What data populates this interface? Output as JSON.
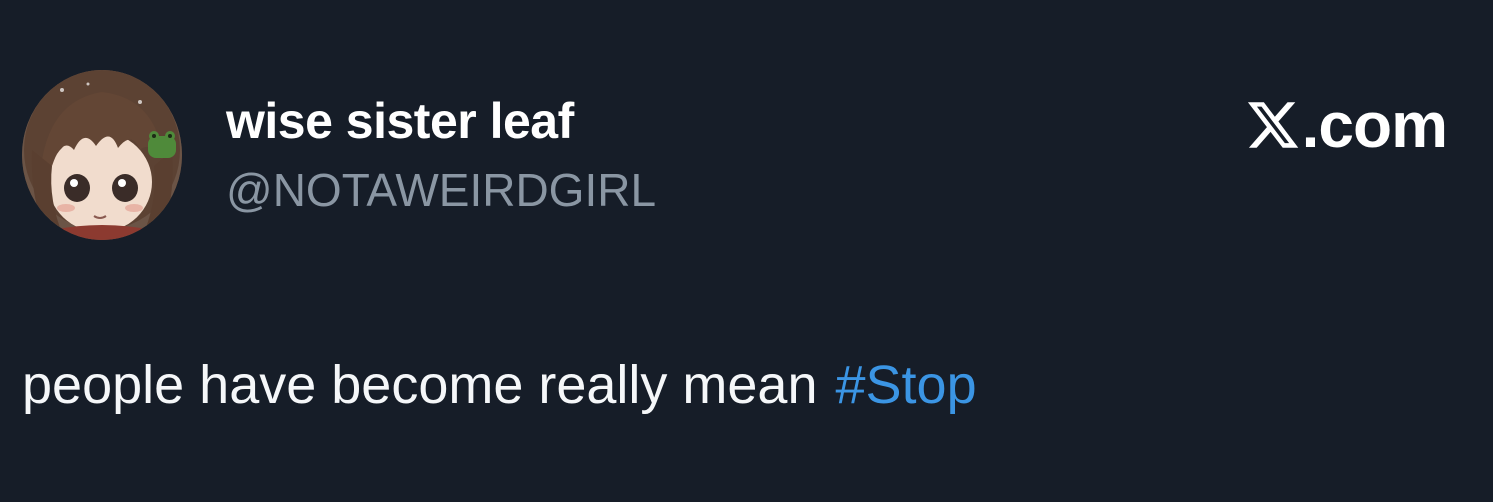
{
  "tweet": {
    "author": {
      "display_name": "wise sister leaf",
      "handle": "@NOTAWEIRDGIRL",
      "avatar_icon": "anime-girl-avatar"
    },
    "brand": {
      "logo_icon": "x-logo-icon",
      "text": ".com"
    },
    "body": {
      "text": "people have become really mean",
      "hashtag": "#Stop"
    }
  },
  "colors": {
    "background": "#161d28",
    "display_name": "#ffffff",
    "handle": "#8a96a3",
    "body_text": "#f5f7f9",
    "hashtag": "#3b95e4"
  }
}
